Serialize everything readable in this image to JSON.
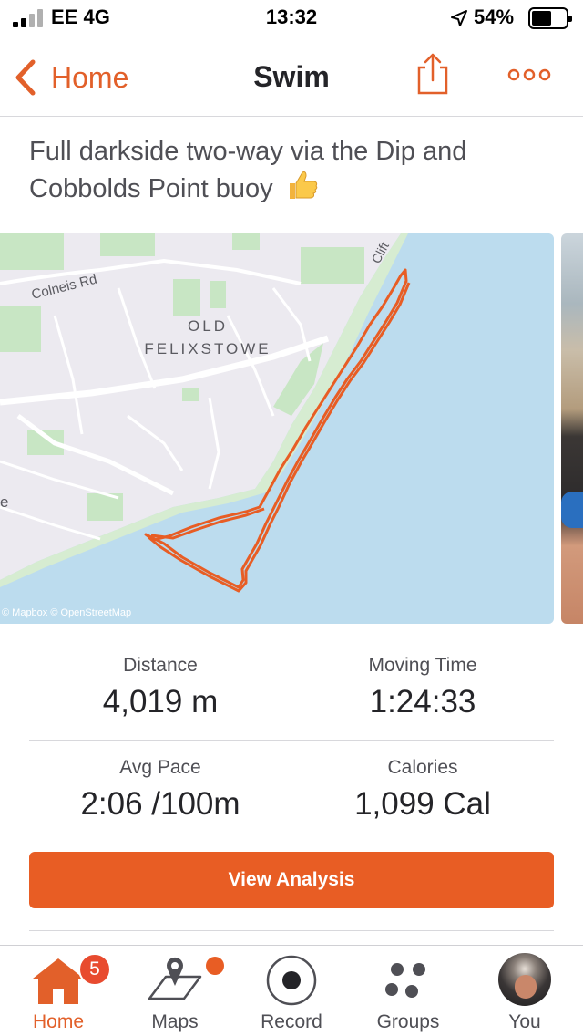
{
  "status_bar": {
    "carrier": "EE  4G",
    "time": "13:32",
    "battery_percent": "54%"
  },
  "nav": {
    "back_label": "Home",
    "title": "Swim"
  },
  "activity": {
    "description": "Full darkside two-way via the Dip and Cobbolds Point buoy"
  },
  "map": {
    "labels": {
      "road": "Colneis Rd",
      "area_line1": "OLD",
      "area_line2": "FELIXSTOWE",
      "cliff": "Clift",
      "edge": "e"
    },
    "attribution": "© Mapbox © OpenStreetMap",
    "route_color": "#e85d24",
    "sea_color": "#bcdcee"
  },
  "stats": {
    "distance": {
      "label": "Distance",
      "value": "4,019 m"
    },
    "moving_time": {
      "label": "Moving Time",
      "value": "1:24:33"
    },
    "avg_pace": {
      "label": "Avg Pace",
      "value": "2:06 /100m"
    },
    "calories": {
      "label": "Calories",
      "value": "1,099 Cal"
    }
  },
  "view_analysis_label": "View Analysis",
  "tabbar": {
    "home": {
      "label": "Home",
      "badge": "5"
    },
    "maps": {
      "label": "Maps"
    },
    "record": {
      "label": "Record"
    },
    "groups": {
      "label": "Groups"
    },
    "you": {
      "label": "You"
    }
  },
  "colors": {
    "accent": "#e2602a",
    "button": "#e85d24",
    "badge": "#e84b2f"
  }
}
